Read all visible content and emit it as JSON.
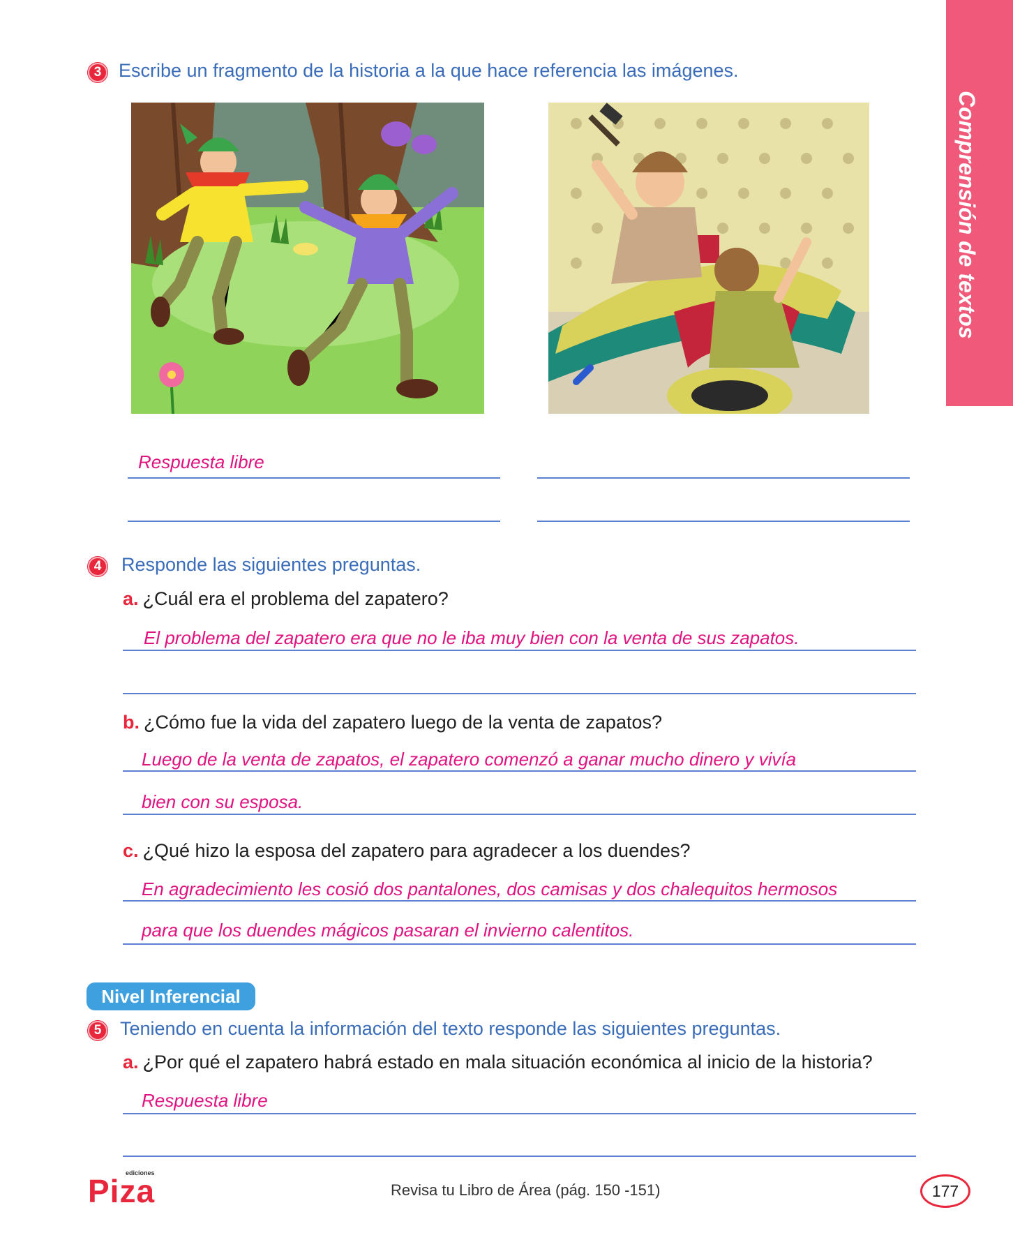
{
  "side_tab": {
    "label": "Comprensión de textos"
  },
  "q3": {
    "number": "3",
    "prompt": "Escribe un fragmento de la historia a la que hace referencia las imágenes.",
    "answer": "Respuesta libre"
  },
  "q4": {
    "number": "4",
    "prompt": "Responde las siguientes preguntas.",
    "a": {
      "letter": "a.",
      "question": "¿Cuál era el problema del zapatero?",
      "answer_1": "El problema del zapatero era que no le iba muy bien con la venta de sus zapatos."
    },
    "b": {
      "letter": "b.",
      "question": "¿Cómo fue la vida del zapatero luego de la venta de zapatos?",
      "answer_1": "Luego de la venta de zapatos, el zapatero comenzó a ganar mucho dinero y vivía",
      "answer_2": "bien con su esposa."
    },
    "c": {
      "letter": "c.",
      "question": "¿Qué hizo la esposa del zapatero para agradecer a los duendes?",
      "answer_1": "En agradecimiento les cosió dos pantalones, dos camisas y dos chalequitos hermosos",
      "answer_2": "para que los duendes mágicos pasaran el invierno calentitos."
    }
  },
  "level_badge": "Nivel Inferencial",
  "q5": {
    "number": "5",
    "prompt": "Teniendo en cuenta la información del texto responde las siguientes preguntas.",
    "a": {
      "letter": "a.",
      "question": "¿Por qué el zapatero habrá estado en mala situación económica al inicio de la historia?",
      "answer_1": "Respuesta libre"
    }
  },
  "footer": {
    "logo_small": "ediciones",
    "logo_main": "Piza",
    "reference": "Revisa tu Libro de Área (pág. 150 -151)",
    "page_number": "177"
  },
  "colors": {
    "accent_red": "#e8263c",
    "question_blue": "#3a6db9",
    "answer_pink": "#e0127f",
    "tab_pink": "#f0597a",
    "badge_blue": "#3fa0df"
  }
}
